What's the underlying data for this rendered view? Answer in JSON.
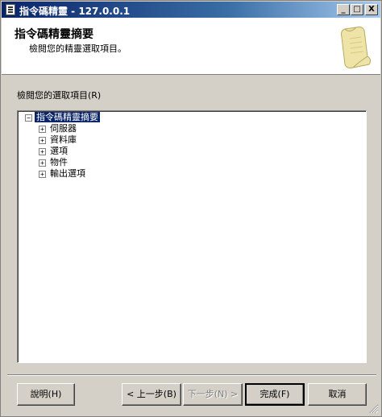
{
  "window": {
    "title": "指令碼精靈 - 127.0.0.1"
  },
  "header": {
    "title": "指令碼精靈摘要",
    "subtitle": "檢閱您的精靈選取項目。"
  },
  "section_label": "檢閱您的選取項目(R)",
  "tree": {
    "root": {
      "label": "指令碼精靈摘要",
      "expanded": true
    },
    "children": [
      {
        "label": "伺服器",
        "expanded": false
      },
      {
        "label": "資料庫",
        "expanded": false
      },
      {
        "label": "選項",
        "expanded": false
      },
      {
        "label": "物件",
        "expanded": false
      },
      {
        "label": "輸出選項",
        "expanded": false
      }
    ]
  },
  "buttons": {
    "help": "說明(H)",
    "back": "< 上一步(B)",
    "next": "下一步(N) >",
    "finish": "完成(F)",
    "cancel": "取消"
  },
  "titlebar_buttons": {
    "minimize": "_",
    "maximize": "□",
    "close": "X"
  }
}
